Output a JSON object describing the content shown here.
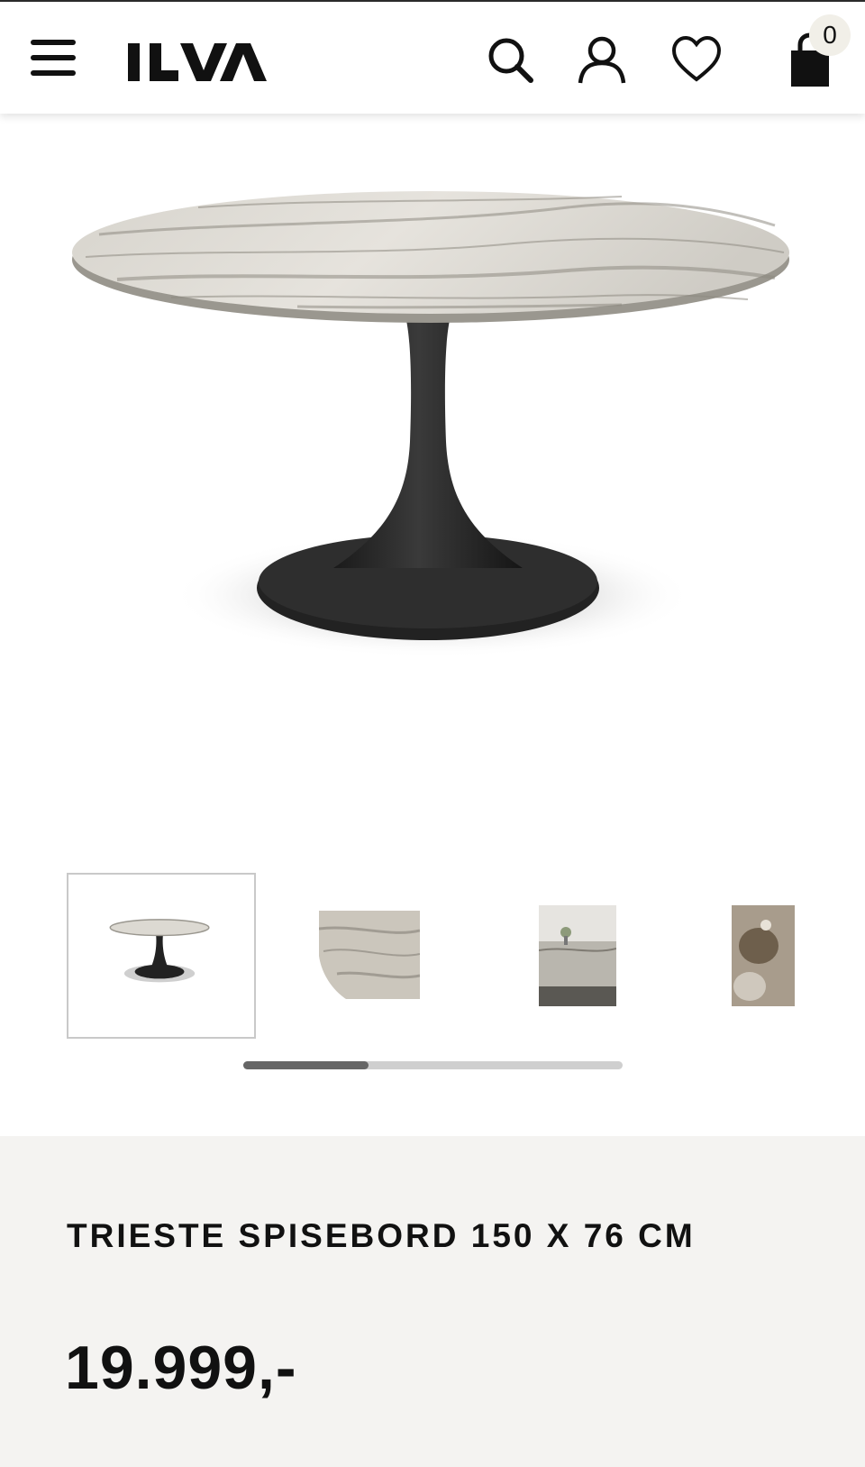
{
  "header": {
    "logo_text": "ILVA",
    "cart_count": "0",
    "icons": [
      "menu-icon",
      "search-icon",
      "user-icon",
      "heart-icon",
      "shopping-bag-icon"
    ]
  },
  "gallery": {
    "thumbnails": [
      "table-product",
      "marble-closeup",
      "table-styled-room",
      "marble-tabletop-decor"
    ],
    "active_index": 0,
    "scroll_progress": 0.33
  },
  "product": {
    "brand": "TRIESTE",
    "name": "SPISEBORD 150 X 76 CM",
    "price": "19.999,-"
  },
  "colors": {
    "background": "#ffffff",
    "info_panel": "#f4f3f1",
    "text": "#111111",
    "scroll_track": "#cfcfcf",
    "scroll_thumb": "#666666"
  }
}
